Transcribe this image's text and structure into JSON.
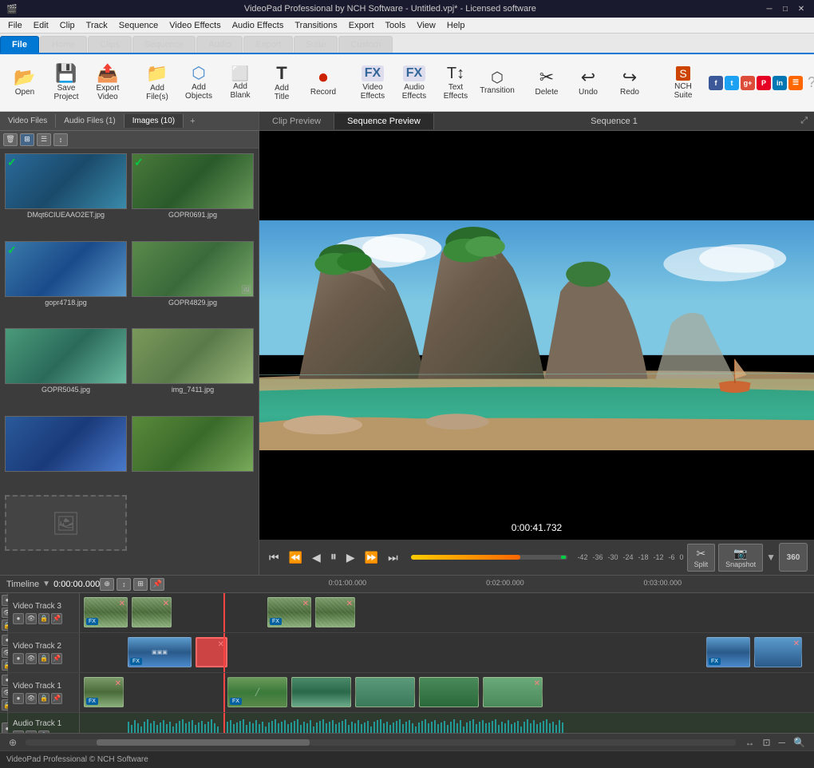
{
  "titlebar": {
    "icon": "🎬",
    "title": "VideoPad Professional by NCH Software - Untitled.vpj* - Licensed software",
    "minimize": "─",
    "maximize": "□",
    "close": "✕"
  },
  "menubar": {
    "items": [
      "File",
      "Edit",
      "Clip",
      "Track",
      "Sequence",
      "Video Effects",
      "Audio Effects",
      "Transitions",
      "Export",
      "Tools",
      "View",
      "Help"
    ]
  },
  "toolbar_tabs": {
    "items": [
      "File",
      "Home",
      "Clips",
      "Sequence",
      "Audio",
      "Export",
      "Suite",
      "Custom"
    ]
  },
  "toolbar": {
    "buttons": [
      {
        "id": "open",
        "icon": "📂",
        "label": "Open"
      },
      {
        "id": "save-project",
        "icon": "💾",
        "label": "Save Project"
      },
      {
        "id": "export-video",
        "icon": "📤",
        "label": "Export Video"
      },
      {
        "id": "add-files",
        "icon": "📁",
        "label": "Add File(s)"
      },
      {
        "id": "add-objects",
        "icon": "🔷",
        "label": "Add Objects"
      },
      {
        "id": "add-blank",
        "icon": "⬜",
        "label": "Add Blank"
      },
      {
        "id": "add-title",
        "icon": "T",
        "label": "Add Title"
      },
      {
        "id": "record",
        "icon": "⏺",
        "label": "Record"
      },
      {
        "id": "video-effects",
        "icon": "FX",
        "label": "Video Effects"
      },
      {
        "id": "audio-effects",
        "icon": "FX",
        "label": "Audio Effects"
      },
      {
        "id": "text-effects",
        "icon": "T↕",
        "label": "Text Effects"
      },
      {
        "id": "transition",
        "icon": "⬡",
        "label": "Transition"
      },
      {
        "id": "delete",
        "icon": "🗑",
        "label": "Delete"
      },
      {
        "id": "undo",
        "icon": "↩",
        "label": "Undo"
      },
      {
        "id": "redo",
        "icon": "↪",
        "label": "Redo"
      },
      {
        "id": "nch-suite",
        "icon": "S",
        "label": "NCH Suite"
      }
    ]
  },
  "file_panel": {
    "tabs": [
      "Video Files",
      "Audio Files (1)",
      "Images (10)"
    ],
    "active_tab": "Images (10)",
    "media_items": [
      {
        "name": "DMqt6CIUEAAO2ET.jpg",
        "thumb_class": "thumb-1",
        "checked": true
      },
      {
        "name": "GOPR0691.jpg",
        "thumb_class": "thumb-2",
        "checked": true
      },
      {
        "name": "gopr4718.jpg",
        "thumb_class": "thumb-3",
        "checked": true
      },
      {
        "name": "GOPR4829.jpg",
        "thumb_class": "thumb-4",
        "checked": false
      },
      {
        "name": "GOPR5045.jpg",
        "thumb_class": "thumb-5",
        "checked": false
      },
      {
        "name": "img_7411.jpg",
        "thumb_class": "thumb-6",
        "checked": false
      },
      {
        "name": "",
        "thumb_class": "thumb-7",
        "checked": false
      },
      {
        "name": "",
        "thumb_class": "thumb-8",
        "checked": false
      },
      {
        "name": "",
        "thumb_class": "thumb-9",
        "checked": false
      }
    ]
  },
  "preview": {
    "tabs": [
      "Clip Preview",
      "Sequence Preview"
    ],
    "active_tab": "Sequence Preview",
    "sequence_title": "Sequence 1",
    "time": "0:00:41.732"
  },
  "preview_controls": {
    "skip_start": "⏮",
    "prev_frame": "⏪",
    "rewind": "◀◀",
    "play_pause": "⏸",
    "forward": "▶▶",
    "next_frame": "⏩",
    "skip_end": "⏭",
    "vol_labels": [
      "-42",
      "-36",
      "-30",
      "-24",
      "-18",
      "-12",
      "-6",
      "0"
    ],
    "split_label": "Split",
    "snapshot_label": "Snapshot",
    "btn_360": "360"
  },
  "timeline": {
    "label": "Timeline",
    "time": "0:00:00.000",
    "ruler_marks": [
      "0:01:00.000",
      "0:02:00.000",
      "0:03:00.000"
    ],
    "tracks": [
      {
        "name": "Video Track 3",
        "type": "video"
      },
      {
        "name": "Video Track 2",
        "type": "video"
      },
      {
        "name": "Video Track 1",
        "type": "video"
      },
      {
        "name": "Audio Track 1",
        "type": "audio"
      }
    ]
  },
  "status_bar": {
    "text": "VideoPad Professional © NCH Software"
  }
}
